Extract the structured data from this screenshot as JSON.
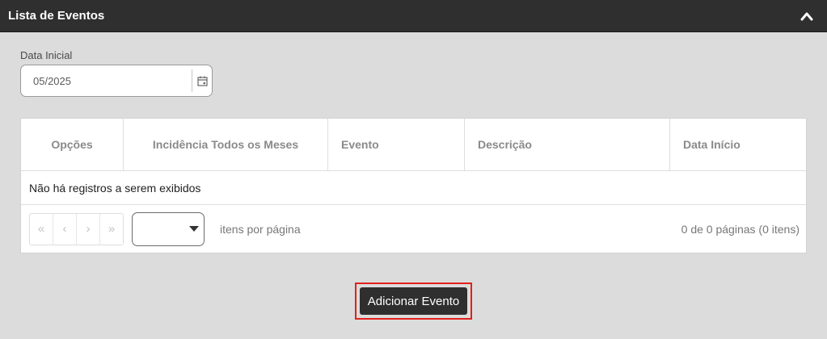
{
  "panel": {
    "title": "Lista de Eventos",
    "collapse_icon": "chevron-up-icon",
    "header_bg": "#2f2f2f"
  },
  "filter": {
    "label": "Data Inicial",
    "value": "05/2025",
    "icon": "calendar-icon"
  },
  "grid": {
    "columns": [
      "Opções",
      "Incidência Todos os Meses",
      "Evento",
      "Descrição",
      "Data Início"
    ],
    "empty_message": "Não há registros a serem exibidos",
    "pager": {
      "first": "«",
      "prev": "‹",
      "next": "›",
      "last": "»",
      "page_size": "",
      "per_page_label": "itens por página",
      "info": "0 de 0 páginas (0 itens)"
    }
  },
  "actions": {
    "add_label": "Adicionar Evento",
    "highlight_color": "#e0211c"
  }
}
